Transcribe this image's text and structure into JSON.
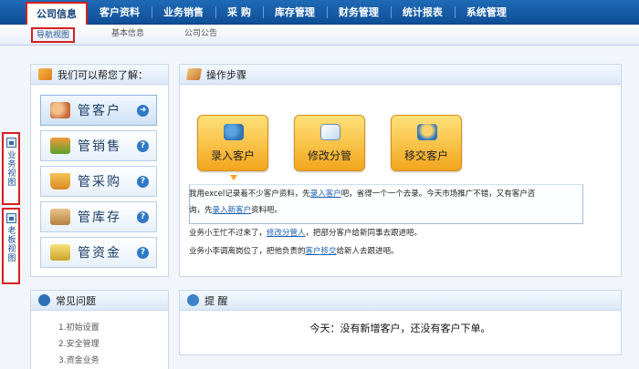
{
  "top_nav": {
    "items": [
      "公司信息",
      "客户资料",
      "业务销售",
      "采 购",
      "库存管理",
      "财务管理",
      "统计报表",
      "系统管理"
    ]
  },
  "sub_nav": {
    "items": [
      "导航视图",
      "基本信息",
      "公司公告"
    ]
  },
  "side_tabs": {
    "business_view": "业务视图",
    "boss_view": "老板视图"
  },
  "help_panel": {
    "title": "我们可以帮您了解：",
    "items": [
      {
        "label": "管客户",
        "icon": "customer-icon"
      },
      {
        "label": "管销售",
        "icon": "sales-icon"
      },
      {
        "label": "管采购",
        "icon": "cart-icon"
      },
      {
        "label": "管库存",
        "icon": "box-icon"
      },
      {
        "label": "管资金",
        "icon": "money-icon"
      }
    ]
  },
  "faq_panel": {
    "title": "常见问题",
    "items": [
      "1.初始设置",
      "2.安全管理",
      "3.资金业务"
    ]
  },
  "steps_panel": {
    "title": "操作步骤",
    "steps": [
      "录入客户",
      "修改分管",
      "移交客户"
    ],
    "desc": {
      "l1_a": "我用excel记录着不少客户资料，先",
      "l1_link": "录入客户",
      "l1_b": "吧，省得一个一个去录。今天市场推广不错，又有客户咨",
      "l2_a": "询，先",
      "l2_link": "录入新客户",
      "l2_b": "资料吧。",
      "l3_a": "业务小王忙不过来了，",
      "l3_link": "修改分管人",
      "l3_b": "，把部分客户给新同事去跟进吧。",
      "l4_a": "业务小李调离岗位了，把他负责的",
      "l4_link": "客户移交",
      "l4_b": "给新人去跟进吧。"
    }
  },
  "remind_panel": {
    "title": "提 醒",
    "message": "今天：没有新增客户，还没有客户下单。"
  },
  "colors": {
    "nav_blue": "#0e4f97",
    "highlight_red": "#d71f1f",
    "step_orange": "#f3a61c"
  }
}
